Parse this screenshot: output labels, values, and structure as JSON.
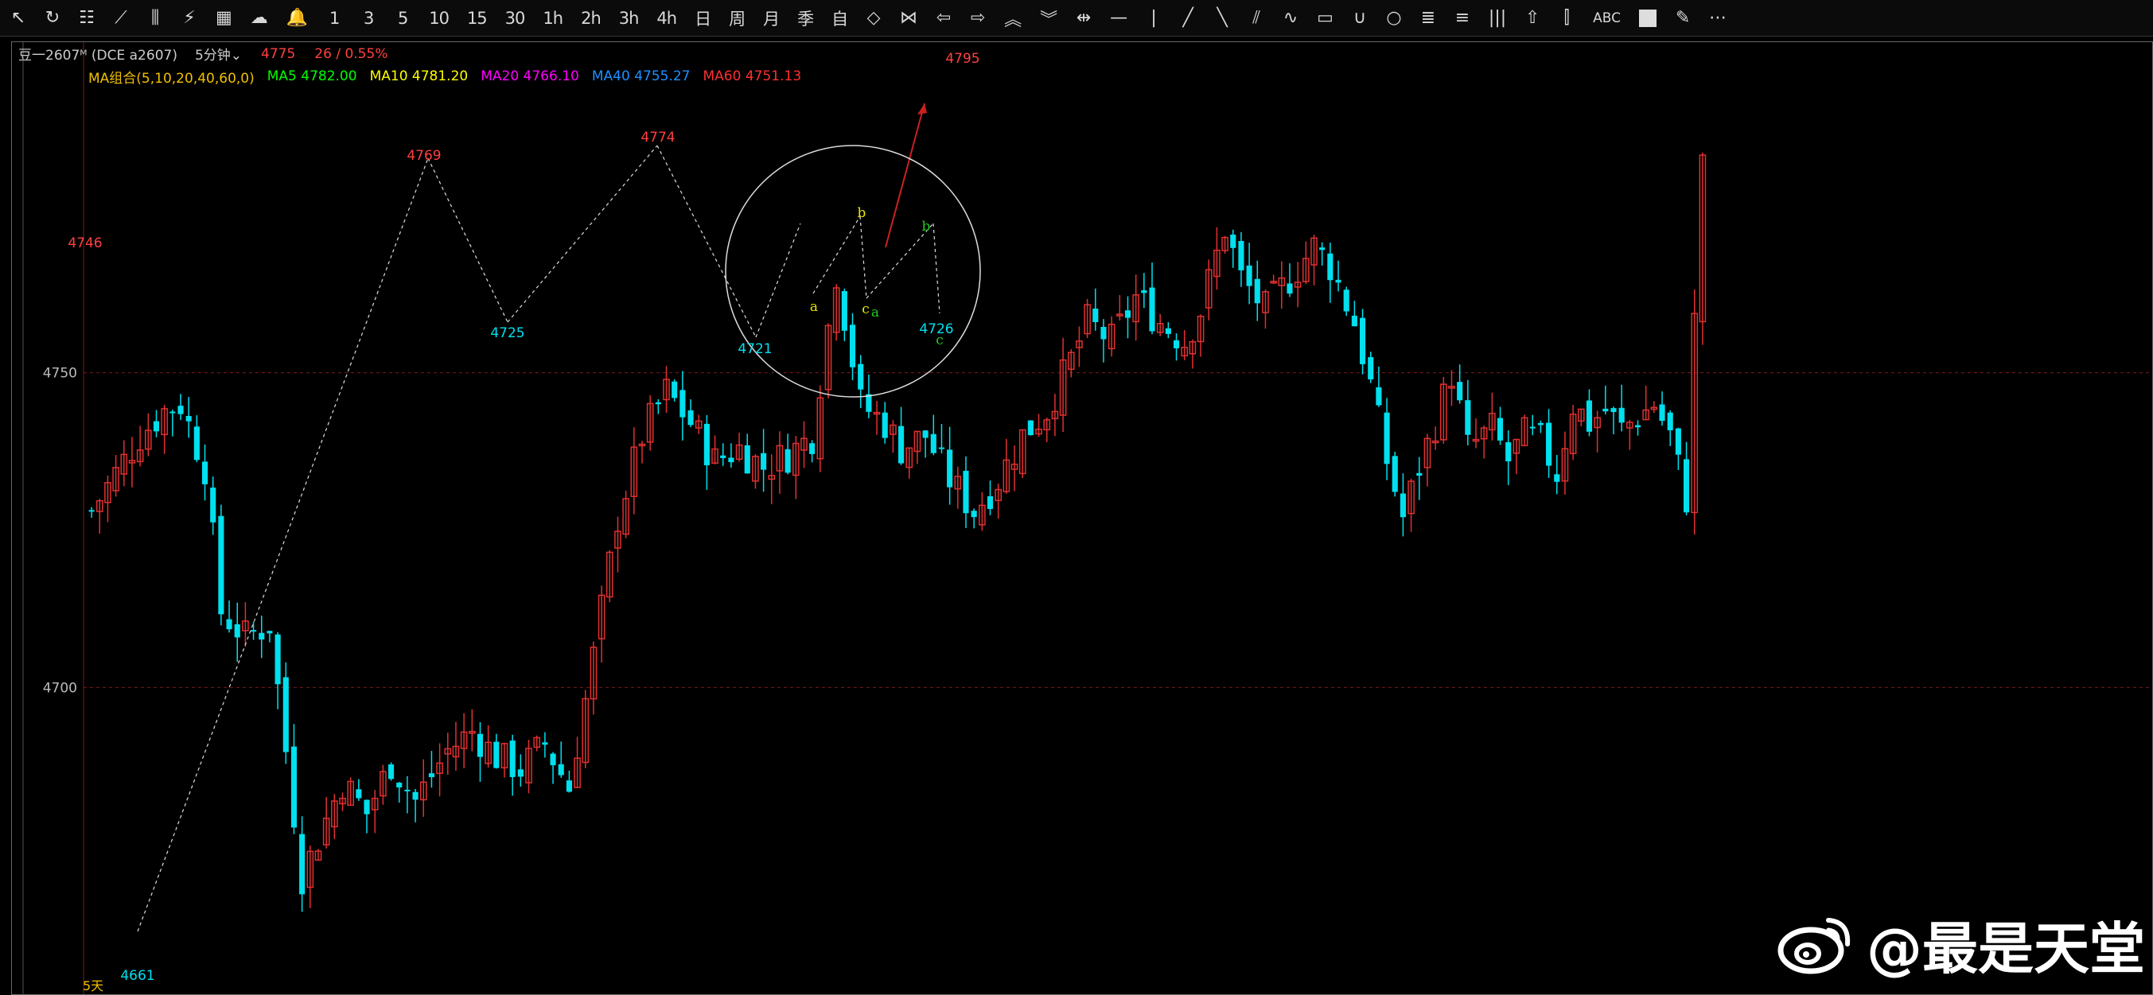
{
  "toolbar": [
    {
      "name": "cursor-icon",
      "label": "↖",
      "type": "icon"
    },
    {
      "name": "refresh-icon",
      "label": "↻",
      "type": "icon"
    },
    {
      "name": "list-icon",
      "label": "☷",
      "type": "icon"
    },
    {
      "name": "line-chart-icon",
      "label": "⟋",
      "type": "icon"
    },
    {
      "name": "candlestick-icon",
      "label": "⫼",
      "type": "icon"
    },
    {
      "name": "flow-icon",
      "label": "⚡",
      "type": "icon"
    },
    {
      "name": "grid-icon",
      "label": "▦",
      "type": "icon"
    },
    {
      "name": "cloud-icon",
      "label": "☁",
      "type": "icon"
    },
    {
      "name": "bell-icon",
      "label": "🔔",
      "type": "icon"
    },
    {
      "name": "period-1m",
      "label": "1",
      "type": "text"
    },
    {
      "name": "period-3m",
      "label": "3",
      "type": "text"
    },
    {
      "name": "period-5m",
      "label": "5",
      "type": "text"
    },
    {
      "name": "period-10m",
      "label": "10",
      "type": "text"
    },
    {
      "name": "period-15m",
      "label": "15",
      "type": "text"
    },
    {
      "name": "period-30m",
      "label": "30",
      "type": "text"
    },
    {
      "name": "period-1h",
      "label": "1h",
      "type": "text"
    },
    {
      "name": "period-2h",
      "label": "2h",
      "type": "text"
    },
    {
      "name": "period-3h",
      "label": "3h",
      "type": "text"
    },
    {
      "name": "period-4h",
      "label": "4h",
      "type": "text"
    },
    {
      "name": "period-day",
      "label": "日",
      "type": "text"
    },
    {
      "name": "period-week",
      "label": "周",
      "type": "text"
    },
    {
      "name": "period-month",
      "label": "月",
      "type": "text"
    },
    {
      "name": "period-quarter",
      "label": "季",
      "type": "text"
    },
    {
      "name": "period-custom",
      "label": "自",
      "type": "text"
    },
    {
      "name": "zoom-in-icon",
      "label": "◇",
      "type": "icon"
    },
    {
      "name": "zoom-out-icon",
      "label": "⋈",
      "type": "icon"
    },
    {
      "name": "arrow-left-icon",
      "label": "⇦",
      "type": "icon"
    },
    {
      "name": "arrow-right-icon",
      "label": "⇨",
      "type": "icon"
    },
    {
      "name": "arrow-up-icon",
      "label": "︽",
      "type": "icon"
    },
    {
      "name": "arrow-down-icon",
      "label": "︾",
      "type": "icon"
    },
    {
      "name": "crosshair-icon",
      "label": "⇹",
      "type": "icon"
    },
    {
      "name": "horizontal-line-icon",
      "label": "—",
      "type": "icon"
    },
    {
      "name": "vertical-line-icon",
      "label": "|",
      "type": "icon"
    },
    {
      "name": "trend-line-icon",
      "label": "╱",
      "type": "icon"
    },
    {
      "name": "ray-line-icon",
      "label": "╲",
      "type": "icon"
    },
    {
      "name": "parallel-lines-icon",
      "label": "⫽",
      "type": "icon"
    },
    {
      "name": "wave-icon",
      "label": "∿",
      "type": "icon"
    },
    {
      "name": "rectangle-icon",
      "label": "▭",
      "type": "icon"
    },
    {
      "name": "arc-icon",
      "label": "∪",
      "type": "icon"
    },
    {
      "name": "circle-icon",
      "label": "○",
      "type": "icon"
    },
    {
      "name": "fib-retracement-icon",
      "label": "≣",
      "type": "icon"
    },
    {
      "name": "fan-icon",
      "label": "≡",
      "type": "icon"
    },
    {
      "name": "period-lines-icon",
      "label": "|||",
      "type": "icon"
    },
    {
      "name": "arrow-mark-icon",
      "label": "⇧",
      "type": "icon"
    },
    {
      "name": "bars-icon",
      "label": "⫿",
      "type": "icon"
    },
    {
      "name": "text-tool",
      "label": "ABC",
      "type": "abg"
    },
    {
      "name": "color-swatch-icon",
      "label": "",
      "type": "square"
    },
    {
      "name": "pen-icon",
      "label": "✎",
      "type": "icon"
    },
    {
      "name": "more-icon",
      "label": "⋯",
      "type": "icon"
    }
  ],
  "header": {
    "symbol": "豆一2607ᴹ (DCE a2607)",
    "period": "5分钟⌄",
    "price": "4775",
    "change": "26 / 0.55%"
  },
  "ma_labels": [
    {
      "text": "MA组合(5,10,20,40,60,0)",
      "color": "#f0c000"
    },
    {
      "text": "MA5 4782.00",
      "color": "#00ff00"
    },
    {
      "text": "MA10 4781.20",
      "color": "#ffff00"
    },
    {
      "text": "MA20 4766.10",
      "color": "#ff00ff"
    },
    {
      "text": "MA40 4755.27",
      "color": "#1e90ff"
    },
    {
      "text": "MA60 4751.13",
      "color": "#ff3030"
    }
  ],
  "colors": {
    "up": "#e03030",
    "down": "#00e0ee",
    "grid": "#7a1a1a",
    "wave_a": "#e6e600",
    "wave_b": "#22cc22",
    "ellipse": "#dddddd",
    "arrow": "#cc2020"
  },
  "chart_data": {
    "type": "candlestick",
    "ylabels": [
      "4750",
      "4700"
    ],
    "ylim": [
      4661,
      4800
    ],
    "bars": 200,
    "pivots": [
      {
        "bar": 0,
        "price": 4661,
        "label": "4661"
      },
      {
        "bar": 2,
        "price": 4746,
        "label": "4746"
      },
      {
        "bar": 66,
        "price": 4769,
        "label": "4769"
      },
      {
        "bar": 82,
        "price": 4725,
        "label": "4725"
      },
      {
        "bar": 103,
        "price": 4774,
        "label": "4774"
      },
      {
        "bar": 127,
        "price": 4721,
        "label": "4721"
      },
      {
        "bar": 137,
        "price": 4739,
        "label": "a"
      },
      {
        "bar": 141,
        "price": 4749,
        "label": "b"
      },
      {
        "bar": 143,
        "price": 4732,
        "label": "c"
      },
      {
        "bar": 143,
        "price": 4730,
        "label": "a"
      },
      {
        "bar": 153,
        "price": 4744,
        "label": "b"
      },
      {
        "bar": 154,
        "price": 4726,
        "label": "4726"
      },
      {
        "bar": 154,
        "price": 4723,
        "label": "c"
      },
      {
        "bar": 160,
        "price": 4795,
        "label": "4795"
      }
    ],
    "close_path": [
      [
        0,
        4728
      ],
      [
        2,
        4732
      ],
      [
        6,
        4740
      ],
      [
        9,
        4744
      ],
      [
        11,
        4745
      ],
      [
        14,
        4735
      ],
      [
        16,
        4712
      ],
      [
        19,
        4708
      ],
      [
        22,
        4710
      ],
      [
        24,
        4690
      ],
      [
        26,
        4670
      ],
      [
        28,
        4676
      ],
      [
        31,
        4685
      ],
      [
        34,
        4680
      ],
      [
        37,
        4688
      ],
      [
        40,
        4682
      ],
      [
        44,
        4690
      ],
      [
        47,
        4693
      ],
      [
        50,
        4689
      ],
      [
        53,
        4687
      ],
      [
        56,
        4691
      ],
      [
        59,
        4684
      ],
      [
        62,
        4705
      ],
      [
        65,
        4727
      ],
      [
        68,
        4740
      ],
      [
        71,
        4747
      ],
      [
        74,
        4742
      ],
      [
        77,
        4736
      ],
      [
        80,
        4738
      ],
      [
        83,
        4735
      ],
      [
        86,
        4737
      ],
      [
        89,
        4740
      ],
      [
        92,
        4766
      ],
      [
        95,
        4745
      ],
      [
        98,
        4742
      ],
      [
        100,
        4738
      ],
      [
        103,
        4740
      ],
      [
        106,
        4733
      ],
      [
        109,
        4728
      ],
      [
        112,
        4733
      ],
      [
        115,
        4740
      ],
      [
        118,
        4744
      ],
      [
        121,
        4752
      ],
      [
        123,
        4758
      ],
      [
        126,
        4755
      ],
      [
        129,
        4762
      ],
      [
        132,
        4758
      ],
      [
        135,
        4755
      ],
      [
        137,
        4760
      ],
      [
        140,
        4773
      ],
      [
        142,
        4765
      ],
      [
        145,
        4760
      ],
      [
        148,
        4765
      ],
      [
        151,
        4770
      ],
      [
        153,
        4767
      ],
      [
        156,
        4758
      ],
      [
        158,
        4748
      ],
      [
        160,
        4736
      ],
      [
        162,
        4727
      ],
      [
        164,
        4735
      ],
      [
        166,
        4742
      ],
      [
        168,
        4750
      ],
      [
        170,
        4738
      ],
      [
        173,
        4741
      ],
      [
        175,
        4736
      ],
      [
        177,
        4740
      ],
      [
        179,
        4739
      ],
      [
        181,
        4734
      ],
      [
        183,
        4745
      ],
      [
        185,
        4742
      ],
      [
        187,
        4744
      ],
      [
        189,
        4741
      ],
      [
        191,
        4743
      ],
      [
        193,
        4745
      ],
      [
        195,
        4740
      ],
      [
        197,
        4730
      ],
      [
        198,
        4758
      ],
      [
        199,
        4785
      ],
      [
        200,
        4785
      ]
    ],
    "wave_lines": [
      [
        [
          172,
          1170
        ],
        [
          537,
          198
        ]
      ],
      [
        [
          537,
          198
        ],
        [
          637,
          404
        ]
      ],
      [
        [
          637,
          404
        ],
        [
          825,
          182
        ]
      ],
      [
        [
          825,
          182
        ],
        [
          949,
          423
        ]
      ],
      [
        [
          949,
          423
        ],
        [
          1005,
          280
        ]
      ],
      [
        [
          1021,
          368
        ],
        [
          1080,
          271
        ]
      ],
      [
        [
          1080,
          271
        ],
        [
          1088,
          374
        ]
      ],
      [
        [
          1088,
          374
        ],
        [
          1172,
          280
        ]
      ],
      [
        [
          1172,
          280
        ],
        [
          1180,
          393
        ]
      ]
    ],
    "trend_arrow": [
      [
        1112,
        310
      ],
      [
        1161,
        129
      ]
    ]
  },
  "watermark": "@最是天堂",
  "bottom_label": "5天"
}
